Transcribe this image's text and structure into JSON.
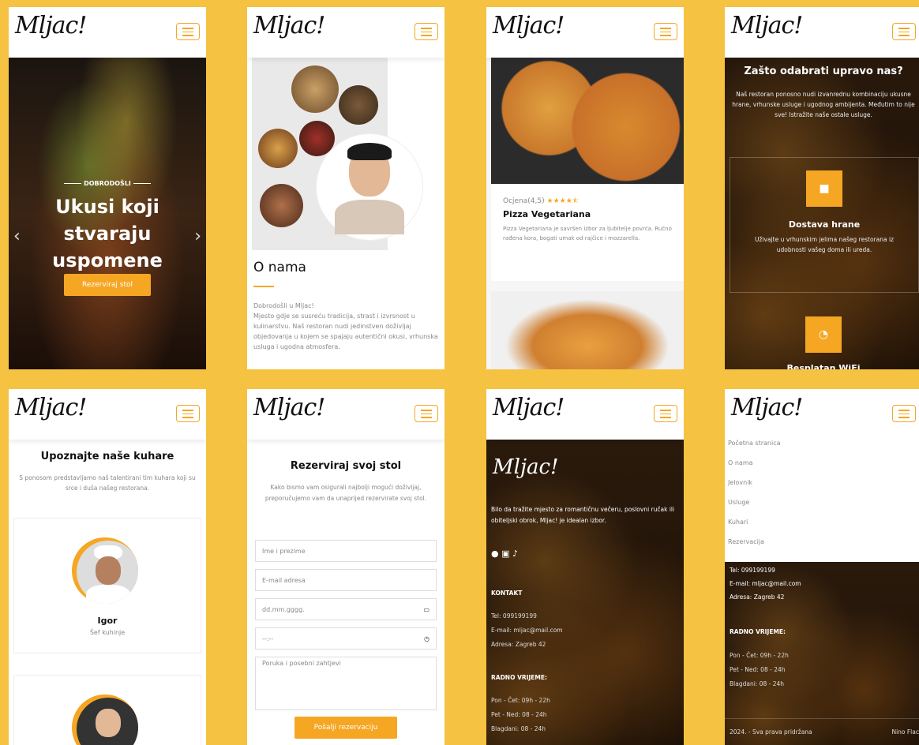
{
  "brand": "Mljac!",
  "hero": {
    "eyebrow": "DOBRODOŠLI",
    "title": "Ukusi koji stvaraju uspomene",
    "button": "Rezerviraj stol",
    "prev": "‹",
    "next": "›"
  },
  "about": {
    "title": "O nama",
    "p1": "Dobrodošli u Mljac!",
    "p2": "Mjesto gdje se susreću tradicija, strast i izvrsnost u kulinarstvu. Naš restoran nudi jedinstven doživljaj objedovanja u kojem se spajaju autentični okusi, vrhunska usluga i ugodna atmosfera."
  },
  "menu_item": {
    "rating_label": "Ocjena(4,5)",
    "stars": "★★★★⯪",
    "name": "Pizza Vegetariana",
    "desc": "Pizza Vegetariana je savršen izbor za ljubitelje povrća. Ručno rađena kora, bogati umak od rajčice i mozzarella."
  },
  "why": {
    "title": "Zašto odabrati upravo nas?",
    "text": "Naš restoran ponosno nudi izvanrednu kombinaciju ukusne hrane, vrhunske usluge i ugodnog ambijenta. Međutim to nije sve! Istražite naše ostale usluge.",
    "s1_title": "Dostava hrane",
    "s1_text": "Uživajte u vrhunskim jelima našeg restorana iz udobnosti vašeg doma ili ureda.",
    "s2_title": "Besplatan WiFi"
  },
  "chefs": {
    "title": "Upoznajte naše kuhare",
    "text": "S ponosom predstavljamo naš talentirani tim kuhara koji su srce i duša našeg restorana.",
    "c1_name": "Igor",
    "c1_role": "Šef kuhinje"
  },
  "reserve": {
    "title": "Rezerviraj svoj stol",
    "text": "Kako bismo vam osigurali najbolji mogući doživljaj, preporučujemo vam da unaprijed rezervirate svoj stol.",
    "name_ph": "Ime i prezime",
    "email_ph": "E-mail adresa",
    "date_ph": "dd.mm.gggg.",
    "time_ph": "--:--",
    "msg_ph": "Poruka i posebni zahtjevi",
    "submit": "Pošalji rezervaciju"
  },
  "footer": {
    "intro": "Bilo da tražite mjesto za romantičnu večeru, poslovni ručak ili obiteljski obrok, Mljac! je idealan izbor.",
    "contact_h": "KONTAKT",
    "tel": "Tel: 099199199",
    "email": "E-mail: mljac@mail.com",
    "address": "Adresa: Zagreb 42",
    "hours_h": "RADNO VRIJEME:",
    "h1": "Pon - Čet: 09h - 22h",
    "h2": "Pet - Ned: 08 - 24h",
    "h3": "Blagdani: 08 - 24h",
    "copyright": "2024. - Sva prava pridržana",
    "author": "Nino Flac"
  },
  "nav": [
    "Početna stranica",
    "O nama",
    "Jelovnik",
    "Usluge",
    "Kuhari",
    "Rezervacija"
  ]
}
